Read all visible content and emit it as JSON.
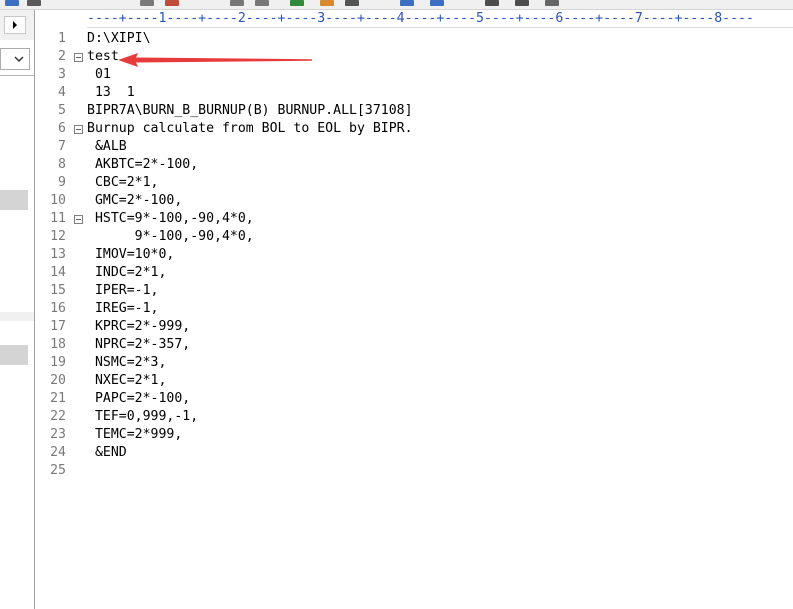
{
  "app": {
    "ruler_text": "----+----1----+----2----+----3----+----4----+----5----+----6----+----7----+----8----"
  },
  "toolbar": {
    "icons": [
      "open-icon",
      "save-icon",
      "print-icon",
      "cut-icon",
      "undo-icon",
      "redo-icon",
      "run-icon",
      "find-icon",
      "replace-icon",
      "zoom-icon",
      "wordwrap-icon",
      "hex-icon",
      "column-icon",
      "settings-icon"
    ]
  },
  "left_panel": {
    "nav_arrow_icon": "chevron-right-icon",
    "combo_icon": "chevron-down-icon"
  },
  "editor": {
    "lines": [
      {
        "num": "1",
        "text": "D:\\XIPI\\",
        "fold": false
      },
      {
        "num": "2",
        "text": "test",
        "fold": true
      },
      {
        "num": "3",
        "text": " 01",
        "fold": false
      },
      {
        "num": "4",
        "text": " 13  1",
        "fold": false
      },
      {
        "num": "5",
        "text": "BIPR7A\\BURN_B_BURNUP(B) BURNUP.ALL[37108]",
        "fold": false
      },
      {
        "num": "6",
        "text": "Burnup calculate from BOL to EOL by BIPR.",
        "fold": true
      },
      {
        "num": "7",
        "text": " &ALB",
        "fold": false
      },
      {
        "num": "8",
        "text": " AKBTC=2*-100,",
        "fold": false
      },
      {
        "num": "9",
        "text": " CBC=2*1,",
        "fold": false
      },
      {
        "num": "10",
        "text": " GMC=2*-100,",
        "fold": false
      },
      {
        "num": "11",
        "text": " HSTC=9*-100,-90,4*0,",
        "fold": true
      },
      {
        "num": "12",
        "text": "      9*-100,-90,4*0,",
        "fold": false
      },
      {
        "num": "13",
        "text": " IMOV=10*0,",
        "fold": false
      },
      {
        "num": "14",
        "text": " INDC=2*1,",
        "fold": false
      },
      {
        "num": "15",
        "text": " IPER=-1,",
        "fold": false
      },
      {
        "num": "16",
        "text": " IREG=-1,",
        "fold": false
      },
      {
        "num": "17",
        "text": " KPRC=2*-999,",
        "fold": false
      },
      {
        "num": "18",
        "text": " NPRC=2*-357,",
        "fold": false
      },
      {
        "num": "19",
        "text": " NSMC=2*3,",
        "fold": false
      },
      {
        "num": "20",
        "text": " NXEC=2*1,",
        "fold": false
      },
      {
        "num": "21",
        "text": " PAPC=2*-100,",
        "fold": false
      },
      {
        "num": "22",
        "text": " TEF=0,999,-1,",
        "fold": false
      },
      {
        "num": "23",
        "text": " TEMC=2*999,",
        "fold": false
      },
      {
        "num": "24",
        "text": " &END",
        "fold": false
      },
      {
        "num": "25",
        "text": "",
        "fold": false
      }
    ]
  },
  "annotation": {
    "color": "#e83a3a"
  }
}
